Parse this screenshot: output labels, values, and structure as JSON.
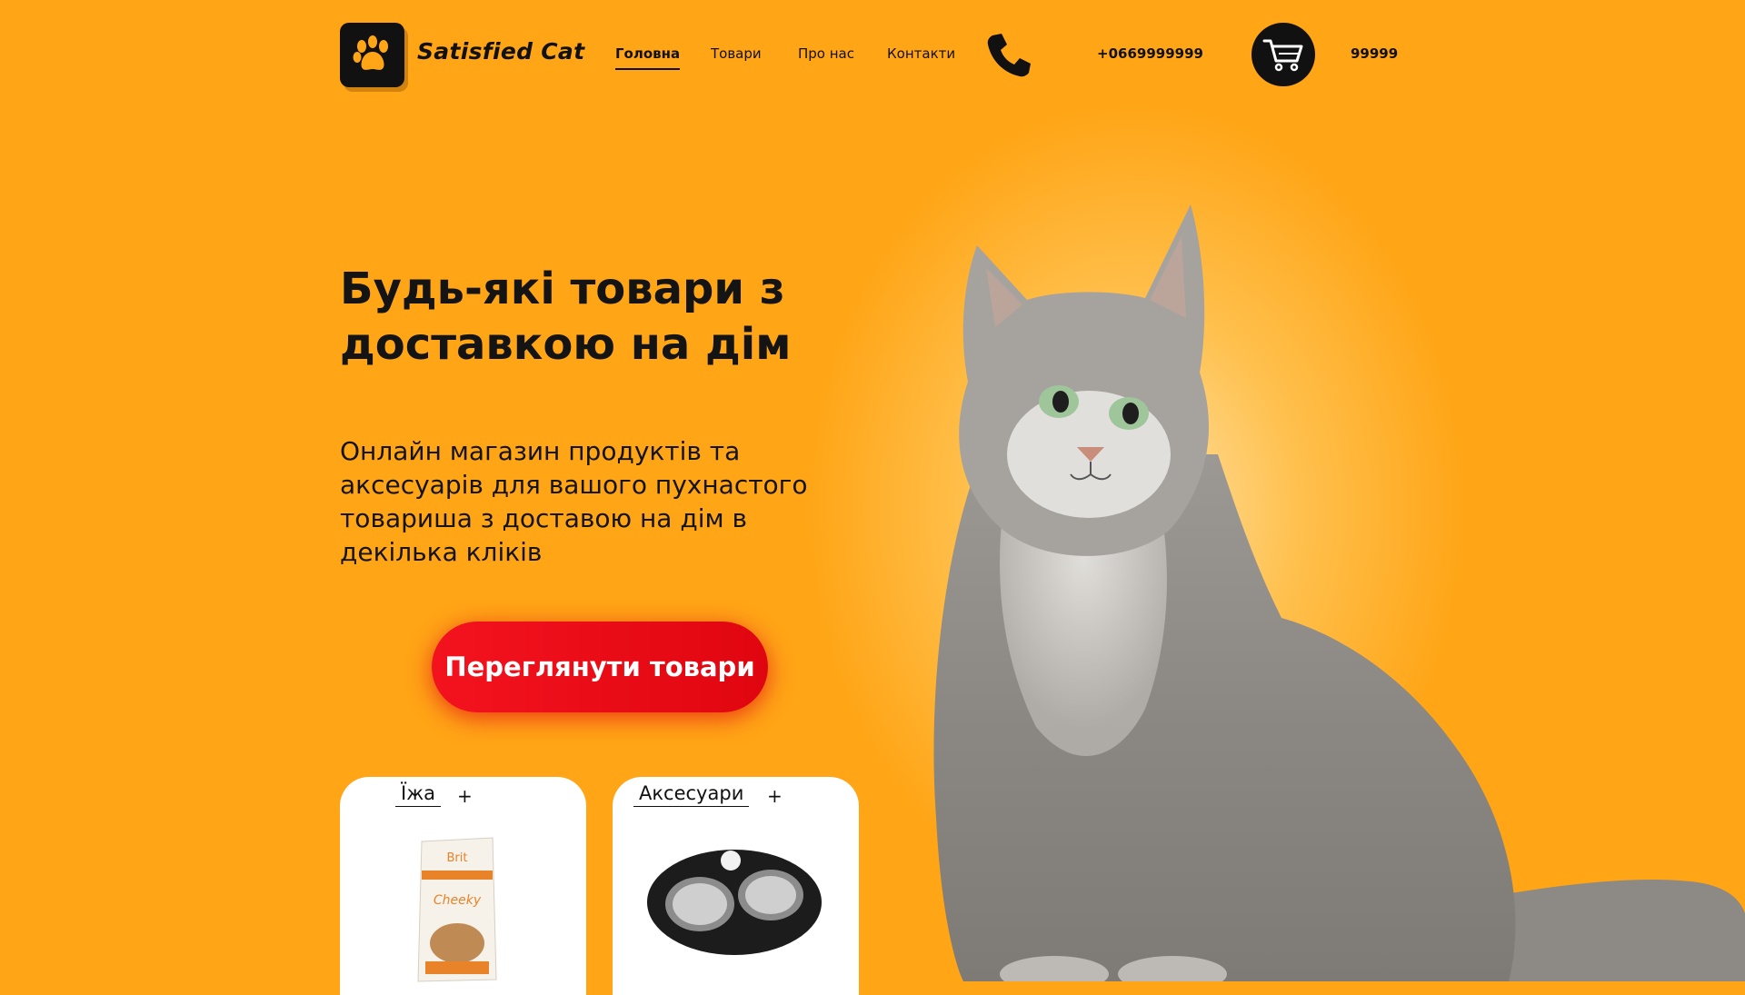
{
  "header": {
    "brand": "Satisfied Cat",
    "nav": [
      {
        "label": "Головна"
      },
      {
        "label": "Товари"
      },
      {
        "label": "Про нас"
      },
      {
        "label": "Контакти"
      }
    ],
    "phone": "+0669999999",
    "cart_count": "99999",
    "icons": {
      "logo": "paw-icon",
      "phone": "phone-icon",
      "cart": "cart-icon"
    }
  },
  "hero": {
    "title": "Будь-які товари з доставкою на дім",
    "subtitle": "Онлайн магазин продуктів та аксесуарів для вашого пухнастого товариша з доставою на дім в декілька кліків",
    "cta": "Переглянути товари"
  },
  "categories": [
    {
      "label": "Їжа",
      "plus": "+"
    },
    {
      "label": "Аксесуари",
      "plus": "+"
    }
  ],
  "colors": {
    "background": "#ffa516",
    "accent": "#e60a14",
    "dark": "#111111"
  }
}
